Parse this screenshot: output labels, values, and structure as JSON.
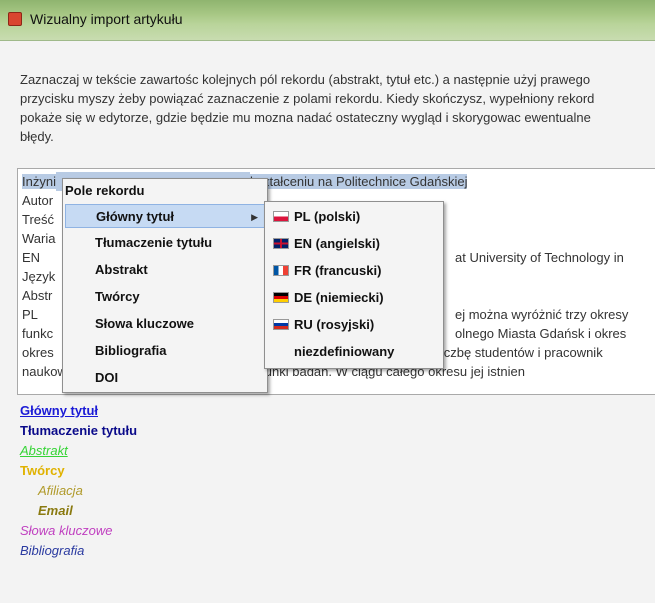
{
  "window": {
    "title": "Wizualny import artykułu"
  },
  "intro": {
    "lines": [
      "Zaznaczaj w tekście zawartośc kolejnych pól rekordu (abstrakt, tytuł etc.) a następnie użyj prawego",
      "przycisku myszy żeby powiązać zaznaczenie z polami rekordu. Kiedy skończysz, wypełniony rekord",
      "pokaże się w edytorze, gdzie będzie mu mozna nadać ostateczny wygląd i skorygowac ewentualne",
      "błędy."
    ]
  },
  "editor": {
    "selected_pre": "Inżyni",
    "selected_post": "kształceniu na Politechnice Gdańskiej",
    "lines": [
      "Autor",
      "Treść",
      "Waria",
      "EN",
      "Język",
      "Abstr",
      "PL",
      "funkc",
      "okres"
    ],
    "right_frags": {
      "en": "at University of Technology in",
      "pl": "ej można wyróżnić trzy okresy",
      "funkc": "olnego Miasta Gdańsk i okres",
      "okres": "powiększyła wielokrotnie liczbę studentów i pracownik"
    },
    "last_line": "naukowo - dydaktycznych, poszerzyła kierunki badań. W ciągu całego okresu jej istnien"
  },
  "context_menu": {
    "header": "Pole rekordu",
    "items": [
      {
        "label": "Główny tytuł",
        "has_submenu": true,
        "active": true
      },
      {
        "label": "Tłumaczenie tytułu",
        "has_submenu": true,
        "active": false
      },
      {
        "label": "Abstrakt",
        "has_submenu": true,
        "active": false
      },
      {
        "label": "Twórcy",
        "has_submenu": true,
        "active": false
      },
      {
        "label": "Słowa kluczowe",
        "has_submenu": true,
        "active": false
      },
      {
        "label": "Bibliografia",
        "has_submenu": false,
        "active": false
      },
      {
        "label": "DOI",
        "has_submenu": false,
        "active": false
      }
    ]
  },
  "language_submenu": {
    "items": [
      {
        "label": "PL (polski)",
        "flag": "pl-flag-icon"
      },
      {
        "label": "EN (angielski)",
        "flag": "en-flag-icon"
      },
      {
        "label": "FR (francuski)",
        "flag": "fr-flag-icon"
      },
      {
        "label": "DE (niemiecki)",
        "flag": "de-flag-icon"
      },
      {
        "label": "RU (rosyjski)",
        "flag": "ru-flag-icon"
      },
      {
        "label": "niezdefiniowany",
        "flag": ""
      }
    ]
  },
  "legend": {
    "items": [
      {
        "label": "Główny tytuł",
        "color": "#1a1ad6"
      },
      {
        "label": "Tłumaczenie tytułu",
        "color": "#0a0a8a"
      },
      {
        "label": "Abstrakt",
        "color": "#35d435"
      },
      {
        "label": "Twórcy",
        "color": "#e0b200"
      },
      {
        "label": "Afiliacja",
        "color": "#b09a2a"
      },
      {
        "label": "Email",
        "color": "#8a7a10"
      },
      {
        "label": "Słowa kluczowe",
        "color": "#c040c0"
      },
      {
        "label": "Bibliografia",
        "color": "#2a3aa0"
      }
    ]
  }
}
